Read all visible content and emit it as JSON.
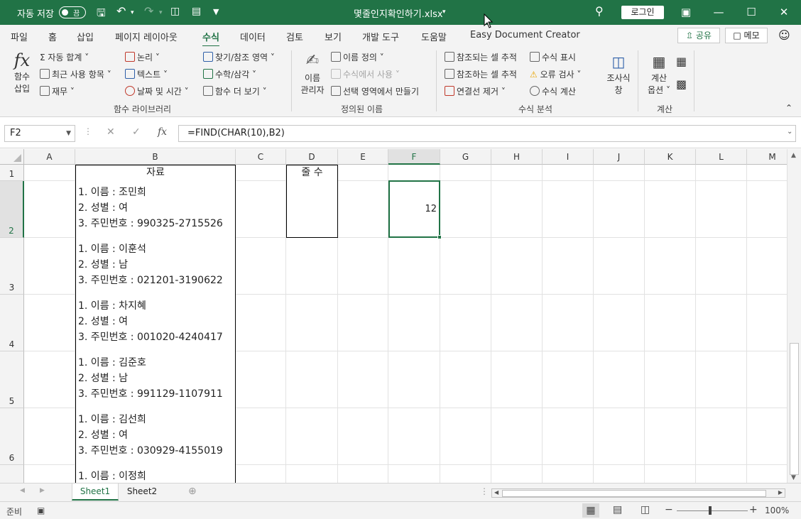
{
  "titlebar": {
    "autosave_label": "자동 저장",
    "autosave_state": "끔",
    "filename": "몇줄인지확인하기.xlsx",
    "login_label": "로그인"
  },
  "tabs": [
    "파일",
    "홈",
    "삽입",
    "페이지 레이아웃",
    "수식",
    "데이터",
    "검토",
    "보기",
    "개발 도구",
    "도움말",
    "Easy Document Creator"
  ],
  "active_tab": "수식",
  "share_label": "공유",
  "memo_label": "메모",
  "ribbon": {
    "insert_function": [
      "함수",
      "삽입"
    ],
    "autosum": "자동 합계",
    "recent": "최근 사용 항목",
    "financial": "재무",
    "logical": "논리",
    "text": "텍스트",
    "datetime": "날짜 및 시간",
    "lookup": "찾기/참조 영역",
    "math": "수학/삼각",
    "more": "함수 더 보기",
    "group_library": "함수 라이브러리",
    "name_manager": [
      "이름",
      "관리자"
    ],
    "define_name": "이름 정의",
    "use_in_formula": "수식에서 사용",
    "create_from_selection": "선택 영역에서 만들기",
    "group_defined": "정의된 이름",
    "trace_precedents": "참조되는 셀 추적",
    "trace_dependents": "참조하는 셀 추적",
    "remove_arrows": "연결선 제거",
    "show_formulas": "수식 표시",
    "error_checking": "오류 검사",
    "evaluate_formula": "수식 계산",
    "watch_window": [
      "조사식",
      "창"
    ],
    "group_audit": "수식 분석",
    "calc_options": [
      "계산",
      "옵션"
    ],
    "group_calc": "계산"
  },
  "formula_bar": {
    "name_box": "F2",
    "formula": "=FIND(CHAR(10),B2)"
  },
  "columns": [
    "A",
    "B",
    "C",
    "D",
    "E",
    "F",
    "G",
    "H",
    "I",
    "J",
    "K",
    "L",
    "M"
  ],
  "selected_column": "F",
  "selected_row": "2",
  "rows": [
    "1",
    "2",
    "3",
    "4",
    "5",
    "6"
  ],
  "header_B": "자료",
  "header_D": "줄 수",
  "cell_F2": "12",
  "records": [
    [
      "1. 이름 : 조민희",
      "2. 성별 : 여",
      "3. 주민번호 : 990325-2715526"
    ],
    [
      "1. 이름 : 이훈석",
      "2. 성별 : 남",
      "3. 주민번호 : 021201-3190622"
    ],
    [
      "1. 이름 : 차지혜",
      "2. 성별 : 여",
      "3. 주민번호 : 001020-4240417"
    ],
    [
      "1. 이름 : 김준호",
      "2. 성별 : 남",
      "3. 주민번호 : 991129-1107911"
    ],
    [
      "1. 이름 : 김선희",
      "2. 성별 : 여",
      "3. 주민번호 : 030929-4155019"
    ],
    [
      "1. 이름 : 이정희"
    ]
  ],
  "sheets": [
    "Sheet1",
    "Sheet2"
  ],
  "active_sheet": "Sheet1",
  "status": {
    "ready": "준비",
    "zoom": "100%"
  },
  "colors": {
    "accent": "#217346"
  }
}
